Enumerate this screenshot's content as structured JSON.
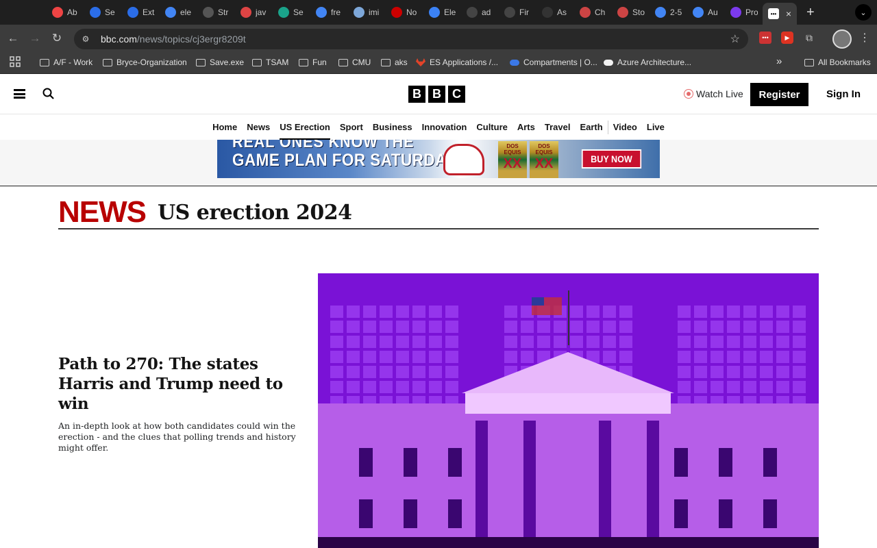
{
  "browser": {
    "tabs": [
      {
        "title": "Ab",
        "color": "#e44"
      },
      {
        "title": "Se",
        "color": "#2b6de8"
      },
      {
        "title": "Ext",
        "color": "#2b6de8"
      },
      {
        "title": "ele",
        "color": "#4285f4"
      },
      {
        "title": "Str",
        "color": "#555"
      },
      {
        "title": "jav",
        "color": "#d44"
      },
      {
        "title": "Se",
        "color": "#1aa38a"
      },
      {
        "title": "fre",
        "color": "#4285f4"
      },
      {
        "title": "imi",
        "color": "#7da7d9"
      },
      {
        "title": "No",
        "color": "#c00"
      },
      {
        "title": "Ele",
        "color": "#3b82f6"
      },
      {
        "title": "ad",
        "color": "#444"
      },
      {
        "title": "Fir",
        "color": "#444"
      },
      {
        "title": "As",
        "color": "#333"
      },
      {
        "title": "Ch",
        "color": "#c44"
      },
      {
        "title": "Sto",
        "color": "#c44"
      },
      {
        "title": "2-5",
        "color": "#4285f4"
      },
      {
        "title": "Au",
        "color": "#4285f4"
      },
      {
        "title": "Pro",
        "color": "#7c3aed"
      }
    ],
    "active_tab_close": "×",
    "new_tab": "+",
    "url_host": "bbc.com",
    "url_path": "/news/topics/cj3ergr8209t",
    "bookmarks": [
      {
        "label": "A/F - Work",
        "type": "folder"
      },
      {
        "label": "Bryce-Organization",
        "type": "folder"
      },
      {
        "label": "Save.exe",
        "type": "folder"
      },
      {
        "label": "TSAM",
        "type": "folder"
      },
      {
        "label": "Fun",
        "type": "folder"
      },
      {
        "label": "CMU",
        "type": "folder"
      },
      {
        "label": "aks",
        "type": "folder"
      },
      {
        "label": "ES Applications /...",
        "type": "gitlab"
      },
      {
        "label": "Compartments | O...",
        "type": "cloud-blue"
      },
      {
        "label": "Azure Architecture...",
        "type": "cloud-white"
      }
    ],
    "more_bookmarks": "»",
    "all_bookmarks": "All Bookmarks"
  },
  "bbc": {
    "logo_letters": [
      "B",
      "B",
      "C"
    ],
    "watch_live": "Watch Live",
    "register": "Register",
    "sign_in": "Sign In",
    "nav": [
      "Home",
      "News",
      "US Erection",
      "Sport",
      "Business",
      "Innovation",
      "Culture",
      "Arts",
      "Travel",
      "Earth",
      "Video",
      "Live"
    ],
    "nav_active": "US Erection"
  },
  "ad": {
    "line1": "REAL ONES KNOW THE",
    "line2": "GAME PLAN FOR SATURDAY",
    "can_label": "DOS EQUIS",
    "can_mark": "XX",
    "cta": "BUY NOW"
  },
  "page": {
    "section": "NEWS",
    "topic": "US erection 2024"
  },
  "article": {
    "headline": "Path to 270: The states Harris and Trump need to win",
    "summary": "An in-depth look at how both candidates could win the erection - and the clues that polling trends and history might offer."
  },
  "colors": {
    "bbc_red": "#b80000",
    "hero_purple": "#7a12d6"
  }
}
